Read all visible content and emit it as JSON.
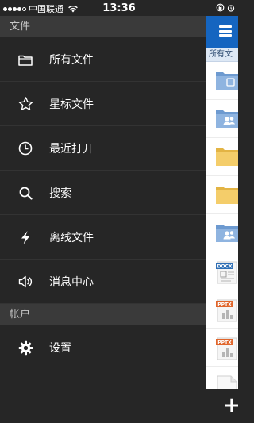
{
  "status_bar": {
    "carrier": "中国联通",
    "time": "13:36",
    "signal_icon": "signal-dots-icon",
    "wifi_icon": "wifi-icon"
  },
  "drawer": {
    "sections": [
      {
        "title": "文件",
        "items": [
          {
            "label": "所有文件",
            "icon": "folder-icon"
          },
          {
            "label": "星标文件",
            "icon": "star-icon"
          },
          {
            "label": "最近打开",
            "icon": "clock-icon"
          },
          {
            "label": "搜索",
            "icon": "search-icon"
          },
          {
            "label": "离线文件",
            "icon": "lightning-icon"
          },
          {
            "label": "消息中心",
            "icon": "speaker-icon"
          }
        ]
      },
      {
        "title": "帐户",
        "items": [
          {
            "label": "设置",
            "icon": "gear-icon"
          }
        ]
      }
    ]
  },
  "content": {
    "title": "所有文",
    "menu_icon": "hamburger-menu-icon",
    "add_icon": "plus-icon",
    "files": [
      {
        "type": "folder-special",
        "badge": ""
      },
      {
        "type": "folder-shared",
        "badge": ""
      },
      {
        "type": "folder",
        "badge": ""
      },
      {
        "type": "folder",
        "badge": ""
      },
      {
        "type": "folder-shared",
        "badge": ""
      },
      {
        "type": "document",
        "badge": "DOCX"
      },
      {
        "type": "presentation",
        "badge": "PPTX"
      },
      {
        "type": "presentation",
        "badge": "PPTX"
      },
      {
        "type": "blank",
        "badge": ""
      }
    ]
  },
  "colors": {
    "drawer_bg": "#262626",
    "section_bg": "#3a3a3a",
    "nav_blue": "#1565c0",
    "folder_blue": "#6d9ad0",
    "folder_yellow": "#f4cd6a",
    "docx_blue": "#2f6fb5",
    "pptx_orange": "#e0662c"
  }
}
